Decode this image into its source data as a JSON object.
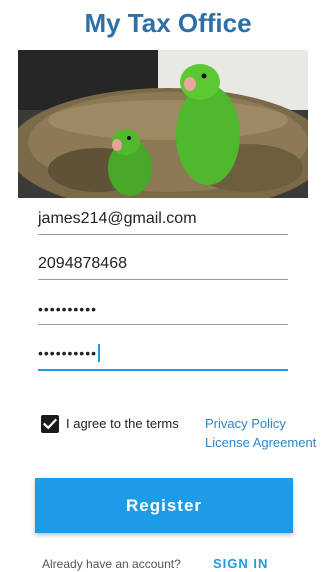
{
  "app": {
    "title": "My Tax Office"
  },
  "hero": {
    "image": "parrots-nest-photo"
  },
  "form": {
    "email_value": "james214@gmail.com",
    "phone_value": "2094878468",
    "password_value": "••••••••••",
    "confirm_password_value": "••••••••••"
  },
  "terms": {
    "checked": true,
    "label": "I agree to the terms",
    "privacy_link": "Privacy Policy",
    "license_link": "License Agreement"
  },
  "actions": {
    "register_label": "Register",
    "account_question": "Already have an account?",
    "signin_label": "SIGN IN"
  },
  "colors": {
    "title": "#2d6fa6",
    "accent": "#1e9be6",
    "link": "#2d86c8"
  }
}
